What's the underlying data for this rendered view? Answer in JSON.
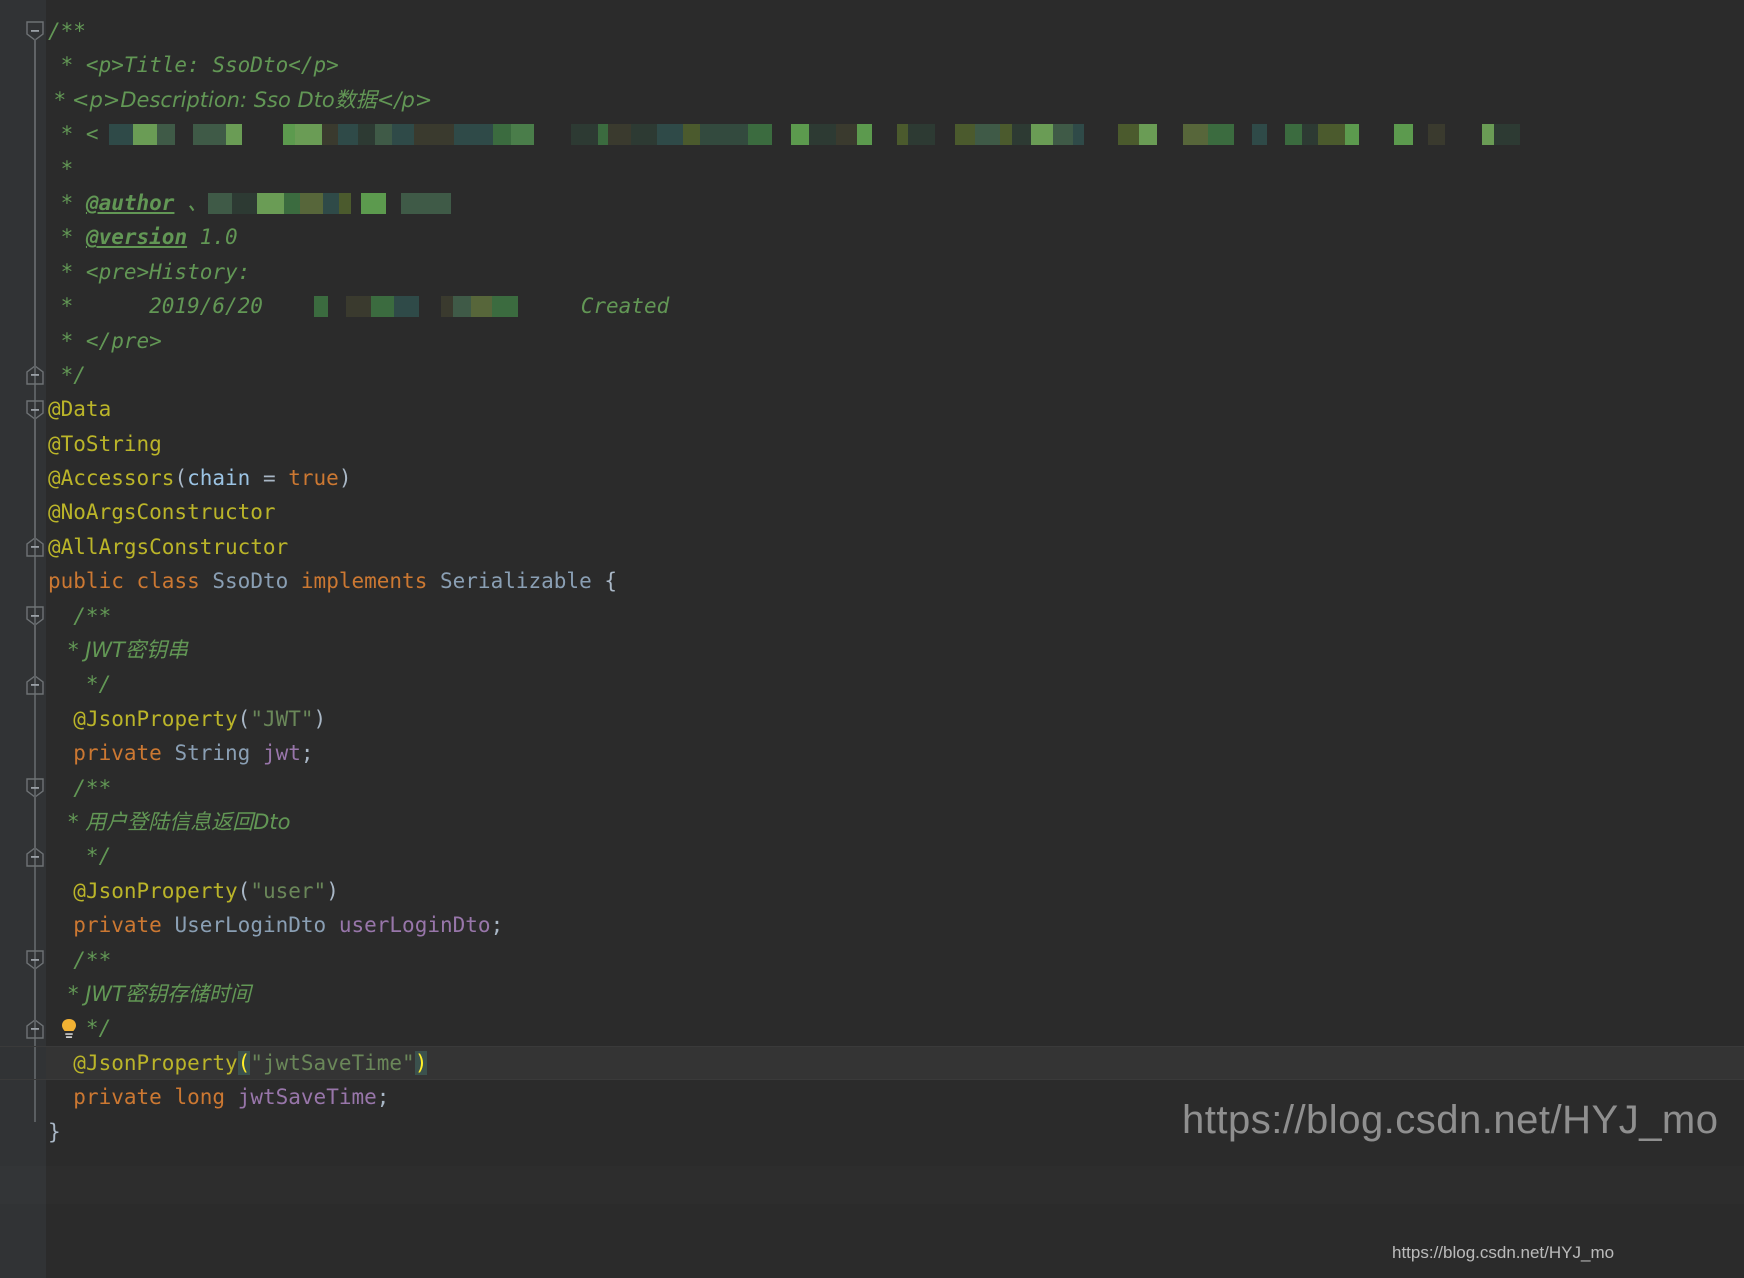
{
  "app": {
    "name": "intellij-idea-editor",
    "theme": "Darcula",
    "background_color": "#2b2b2b",
    "gutter_color": "#313335",
    "current_line_color": "#323232"
  },
  "colors": {
    "comment_green": "#629755",
    "annotation_yellow": "#bbb529",
    "keyword_orange": "#cc7832",
    "string_green": "#6a8759",
    "field_purple": "#9876aa",
    "class_blue": "#8a9fb4",
    "param_blue": "#9cc4e4",
    "brace_match_bg": "#3b514d",
    "brace_match_fg": "#ffef28",
    "bulb_color": "#f2b233"
  },
  "icons": {
    "fold_collapse": "minus-box",
    "fold_end": "minus-box-end",
    "intention_bulb": "lightbulb"
  },
  "code": {
    "language": "Java",
    "class_name": "SsoDto",
    "lines": [
      {
        "n": 1,
        "tokens": [
          {
            "t": "cmt",
            "v": "/**"
          }
        ],
        "fold": "start"
      },
      {
        "n": 2,
        "tokens": [
          {
            "t": "cmt",
            "v": " * <p>Title: SsoDto</p>"
          }
        ]
      },
      {
        "n": 3,
        "tokens": [
          {
            "t": "cmt",
            "v": " * <p>Description: Sso Dto数据</p>"
          }
        ]
      },
      {
        "n": 4,
        "tokens": [
          {
            "t": "cmt",
            "v": " * <"
          },
          {
            "t": "redact",
            "v": "redacted-content"
          }
        ]
      },
      {
        "n": 5,
        "tokens": [
          {
            "t": "cmt",
            "v": " *"
          }
        ]
      },
      {
        "n": 6,
        "tokens": [
          {
            "t": "cmt",
            "v": " * "
          },
          {
            "t": "cmt-tag",
            "v": "@author"
          },
          {
            "t": "cmt",
            "v": " 、"
          },
          {
            "t": "redact",
            "v": "redacted-author"
          }
        ]
      },
      {
        "n": 7,
        "tokens": [
          {
            "t": "cmt",
            "v": " * "
          },
          {
            "t": "cmt-tag",
            "v": "@version"
          },
          {
            "t": "cmt",
            "v": " 1.0"
          }
        ]
      },
      {
        "n": 8,
        "tokens": [
          {
            "t": "cmt",
            "v": " * <pre>History:"
          }
        ]
      },
      {
        "n": 9,
        "tokens": [
          {
            "t": "cmt",
            "v": " *      2019/6/20    "
          },
          {
            "t": "redact",
            "v": "redacted-name"
          },
          {
            "t": "cmt",
            "v": "     Created"
          }
        ]
      },
      {
        "n": 10,
        "tokens": [
          {
            "t": "cmt",
            "v": " * </pre>"
          }
        ]
      },
      {
        "n": 11,
        "tokens": [
          {
            "t": "cmt",
            "v": " */"
          }
        ],
        "fold": "end"
      },
      {
        "n": 12,
        "tokens": [
          {
            "t": "anno",
            "v": "@Data"
          }
        ],
        "fold": "start"
      },
      {
        "n": 13,
        "tokens": [
          {
            "t": "anno",
            "v": "@ToString"
          }
        ]
      },
      {
        "n": 14,
        "tokens": [
          {
            "t": "anno",
            "v": "@Accessors"
          },
          {
            "t": "paren",
            "v": "("
          },
          {
            "t": "param",
            "v": "chain"
          },
          {
            "t": "punct",
            "v": " = "
          },
          {
            "t": "kw",
            "v": "true"
          },
          {
            "t": "paren",
            "v": ")"
          }
        ]
      },
      {
        "n": 15,
        "tokens": [
          {
            "t": "anno",
            "v": "@NoArgsConstructor"
          }
        ]
      },
      {
        "n": 16,
        "tokens": [
          {
            "t": "anno",
            "v": "@AllArgsConstructor"
          }
        ],
        "fold": "end"
      },
      {
        "n": 17,
        "tokens": [
          {
            "t": "kw",
            "v": "public"
          },
          {
            "t": "punct",
            "v": " "
          },
          {
            "t": "kw",
            "v": "class"
          },
          {
            "t": "punct",
            "v": " "
          },
          {
            "t": "clsref",
            "v": "SsoDto"
          },
          {
            "t": "punct",
            "v": " "
          },
          {
            "t": "kw",
            "v": "implements"
          },
          {
            "t": "punct",
            "v": " "
          },
          {
            "t": "clsref",
            "v": "Serializable"
          },
          {
            "t": "punct",
            "v": " {"
          }
        ]
      },
      {
        "n": 18,
        "tokens": [
          {
            "t": "cmt",
            "v": "  /**"
          }
        ],
        "fold": "start"
      },
      {
        "n": 19,
        "tokens": [
          {
            "t": "cmt",
            "v": "   * JWT密钥串"
          }
        ]
      },
      {
        "n": 20,
        "tokens": [
          {
            "t": "cmt",
            "v": "   */"
          }
        ],
        "fold": "end"
      },
      {
        "n": 21,
        "tokens": [
          {
            "t": "punct",
            "v": "  "
          },
          {
            "t": "anno",
            "v": "@JsonProperty"
          },
          {
            "t": "paren",
            "v": "("
          },
          {
            "t": "str",
            "v": "\"JWT\""
          },
          {
            "t": "paren",
            "v": ")"
          }
        ]
      },
      {
        "n": 22,
        "tokens": [
          {
            "t": "punct",
            "v": "  "
          },
          {
            "t": "kw",
            "v": "private"
          },
          {
            "t": "punct",
            "v": " "
          },
          {
            "t": "clsref",
            "v": "String"
          },
          {
            "t": "punct",
            "v": " "
          },
          {
            "t": "field",
            "v": "jwt"
          },
          {
            "t": "punct",
            "v": ";"
          }
        ]
      },
      {
        "n": 23,
        "tokens": [
          {
            "t": "cmt",
            "v": "  /**"
          }
        ],
        "fold": "start"
      },
      {
        "n": 24,
        "tokens": [
          {
            "t": "cmt",
            "v": "   * 用户登陆信息返回Dto"
          }
        ]
      },
      {
        "n": 25,
        "tokens": [
          {
            "t": "cmt",
            "v": "   */"
          }
        ],
        "fold": "end"
      },
      {
        "n": 26,
        "tokens": [
          {
            "t": "punct",
            "v": "  "
          },
          {
            "t": "anno",
            "v": "@JsonProperty"
          },
          {
            "t": "paren",
            "v": "("
          },
          {
            "t": "str",
            "v": "\"user\""
          },
          {
            "t": "paren",
            "v": ")"
          }
        ]
      },
      {
        "n": 27,
        "tokens": [
          {
            "t": "punct",
            "v": "  "
          },
          {
            "t": "kw",
            "v": "private"
          },
          {
            "t": "punct",
            "v": " "
          },
          {
            "t": "clsref",
            "v": "UserLoginDto"
          },
          {
            "t": "punct",
            "v": " "
          },
          {
            "t": "field",
            "v": "userLoginDto"
          },
          {
            "t": "punct",
            "v": ";"
          }
        ]
      },
      {
        "n": 28,
        "tokens": [
          {
            "t": "cmt",
            "v": "  /**"
          }
        ],
        "fold": "start"
      },
      {
        "n": 29,
        "tokens": [
          {
            "t": "cmt",
            "v": "   * JWT密钥存储时间"
          }
        ]
      },
      {
        "n": 30,
        "tokens": [
          {
            "t": "cmt",
            "v": "   */"
          }
        ],
        "fold": "end",
        "bulb": true
      },
      {
        "n": 31,
        "current": true,
        "tokens": [
          {
            "t": "punct",
            "v": "  "
          },
          {
            "t": "anno",
            "v": "@JsonProperty"
          },
          {
            "t": "bracematch",
            "v": "("
          },
          {
            "t": "str",
            "v": "\"jwtSaveTime\""
          },
          {
            "t": "bracematch",
            "v": ")"
          }
        ]
      },
      {
        "n": 32,
        "tokens": [
          {
            "t": "punct",
            "v": "  "
          },
          {
            "t": "kw",
            "v": "private"
          },
          {
            "t": "punct",
            "v": " "
          },
          {
            "t": "kw",
            "v": "long"
          },
          {
            "t": "punct",
            "v": " "
          },
          {
            "t": "field",
            "v": "jwtSaveTime"
          },
          {
            "t": "punct",
            "v": ";"
          }
        ]
      },
      {
        "n": 33,
        "tokens": [
          {
            "t": "punct",
            "v": "}"
          }
        ]
      }
    ]
  },
  "watermarks": {
    "large": "https://blog.csdn.net/HYJ_mo",
    "small": "https://blog.csdn.net/HYJ_mo"
  }
}
